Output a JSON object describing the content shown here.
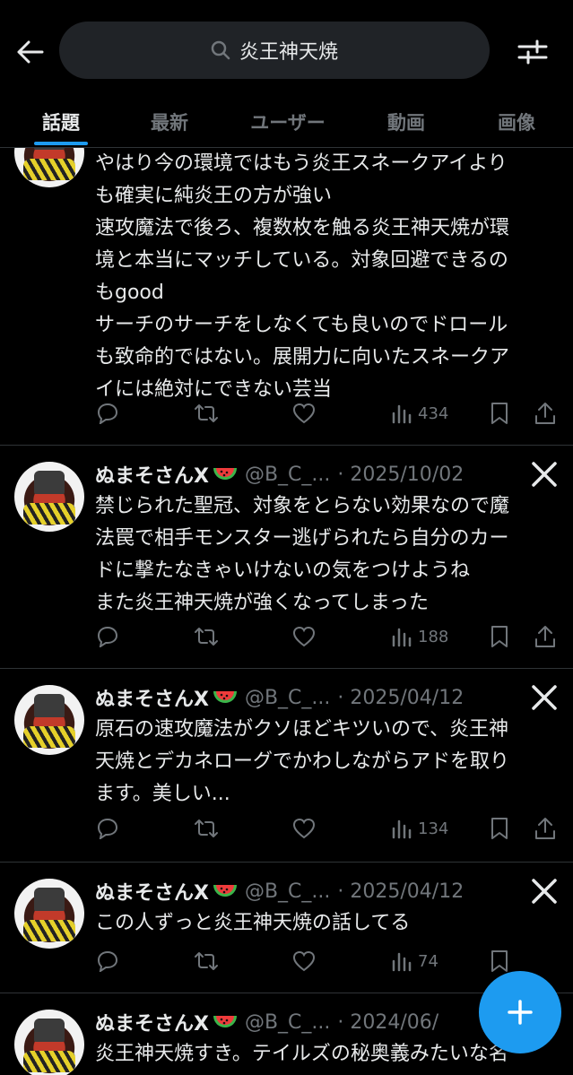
{
  "search": {
    "query": "炎王神天焼"
  },
  "tabs": [
    {
      "label": "話題",
      "active": true
    },
    {
      "label": "最新",
      "active": false
    },
    {
      "label": "ユーザー",
      "active": false
    },
    {
      "label": "動画",
      "active": false
    },
    {
      "label": "画像",
      "active": false
    }
  ],
  "tweets": [
    {
      "text": "やはり今の環境ではもう炎王スネークアイより\nも確実に純炎王の方が強い\n速攻魔法で後ろ、複数枚を触る炎王神天焼が環\n境と本当にマッチしている。対象回避できるの\nもgood\nサーチのサーチをしなくても良いのでドロール\nも致命的ではない。展開力に向いたスネークア\nイには絶対にできない芸当",
      "views": "434"
    },
    {
      "name": "ぬまそさんX",
      "handle": "@B_C_...",
      "date": "· 2025/10/02",
      "text": "禁じられた聖冠、対象をとらない効果なので魔\n法罠で相手モンスター逃げられたら自分のカー\nドに撃たなきゃいけないの気をつけようね\nまた炎王神天焼が強くなってしまった",
      "views": "188"
    },
    {
      "name": "ぬまそさんX",
      "handle": "@B_C_...",
      "date": "· 2025/04/12",
      "text": "原石の速攻魔法がクソほどキツいので、炎王神\n天焼とデカネローグでかわしながらアドを取り\nます。美しい...",
      "views": "134"
    },
    {
      "name": "ぬまそさんX",
      "handle": "@B_C_...",
      "date": "· 2025/04/12",
      "text": "この人ずっと炎王神天焼の話してる",
      "views": "74"
    },
    {
      "name": "ぬまそさんX",
      "handle": "@B_C_...",
      "date": "· 2024/06/",
      "text": "炎王神天焼すき。テイルズの秘奥義みたいな名"
    }
  ],
  "colors": {
    "accent": "#1d9bf0",
    "muted": "#71767b",
    "text": "#e7e9ea",
    "divider": "#2f3336"
  },
  "icons": {
    "back": "arrow-left-icon",
    "search": "search-icon",
    "filter": "filter-sliders-icon",
    "reply": "reply-icon",
    "retweet": "retweet-icon",
    "like": "heart-icon",
    "views": "views-bar-icon",
    "bookmark": "bookmark-icon",
    "share": "share-icon",
    "x_logo": "x-logo-icon",
    "compose": "plus-icon"
  }
}
